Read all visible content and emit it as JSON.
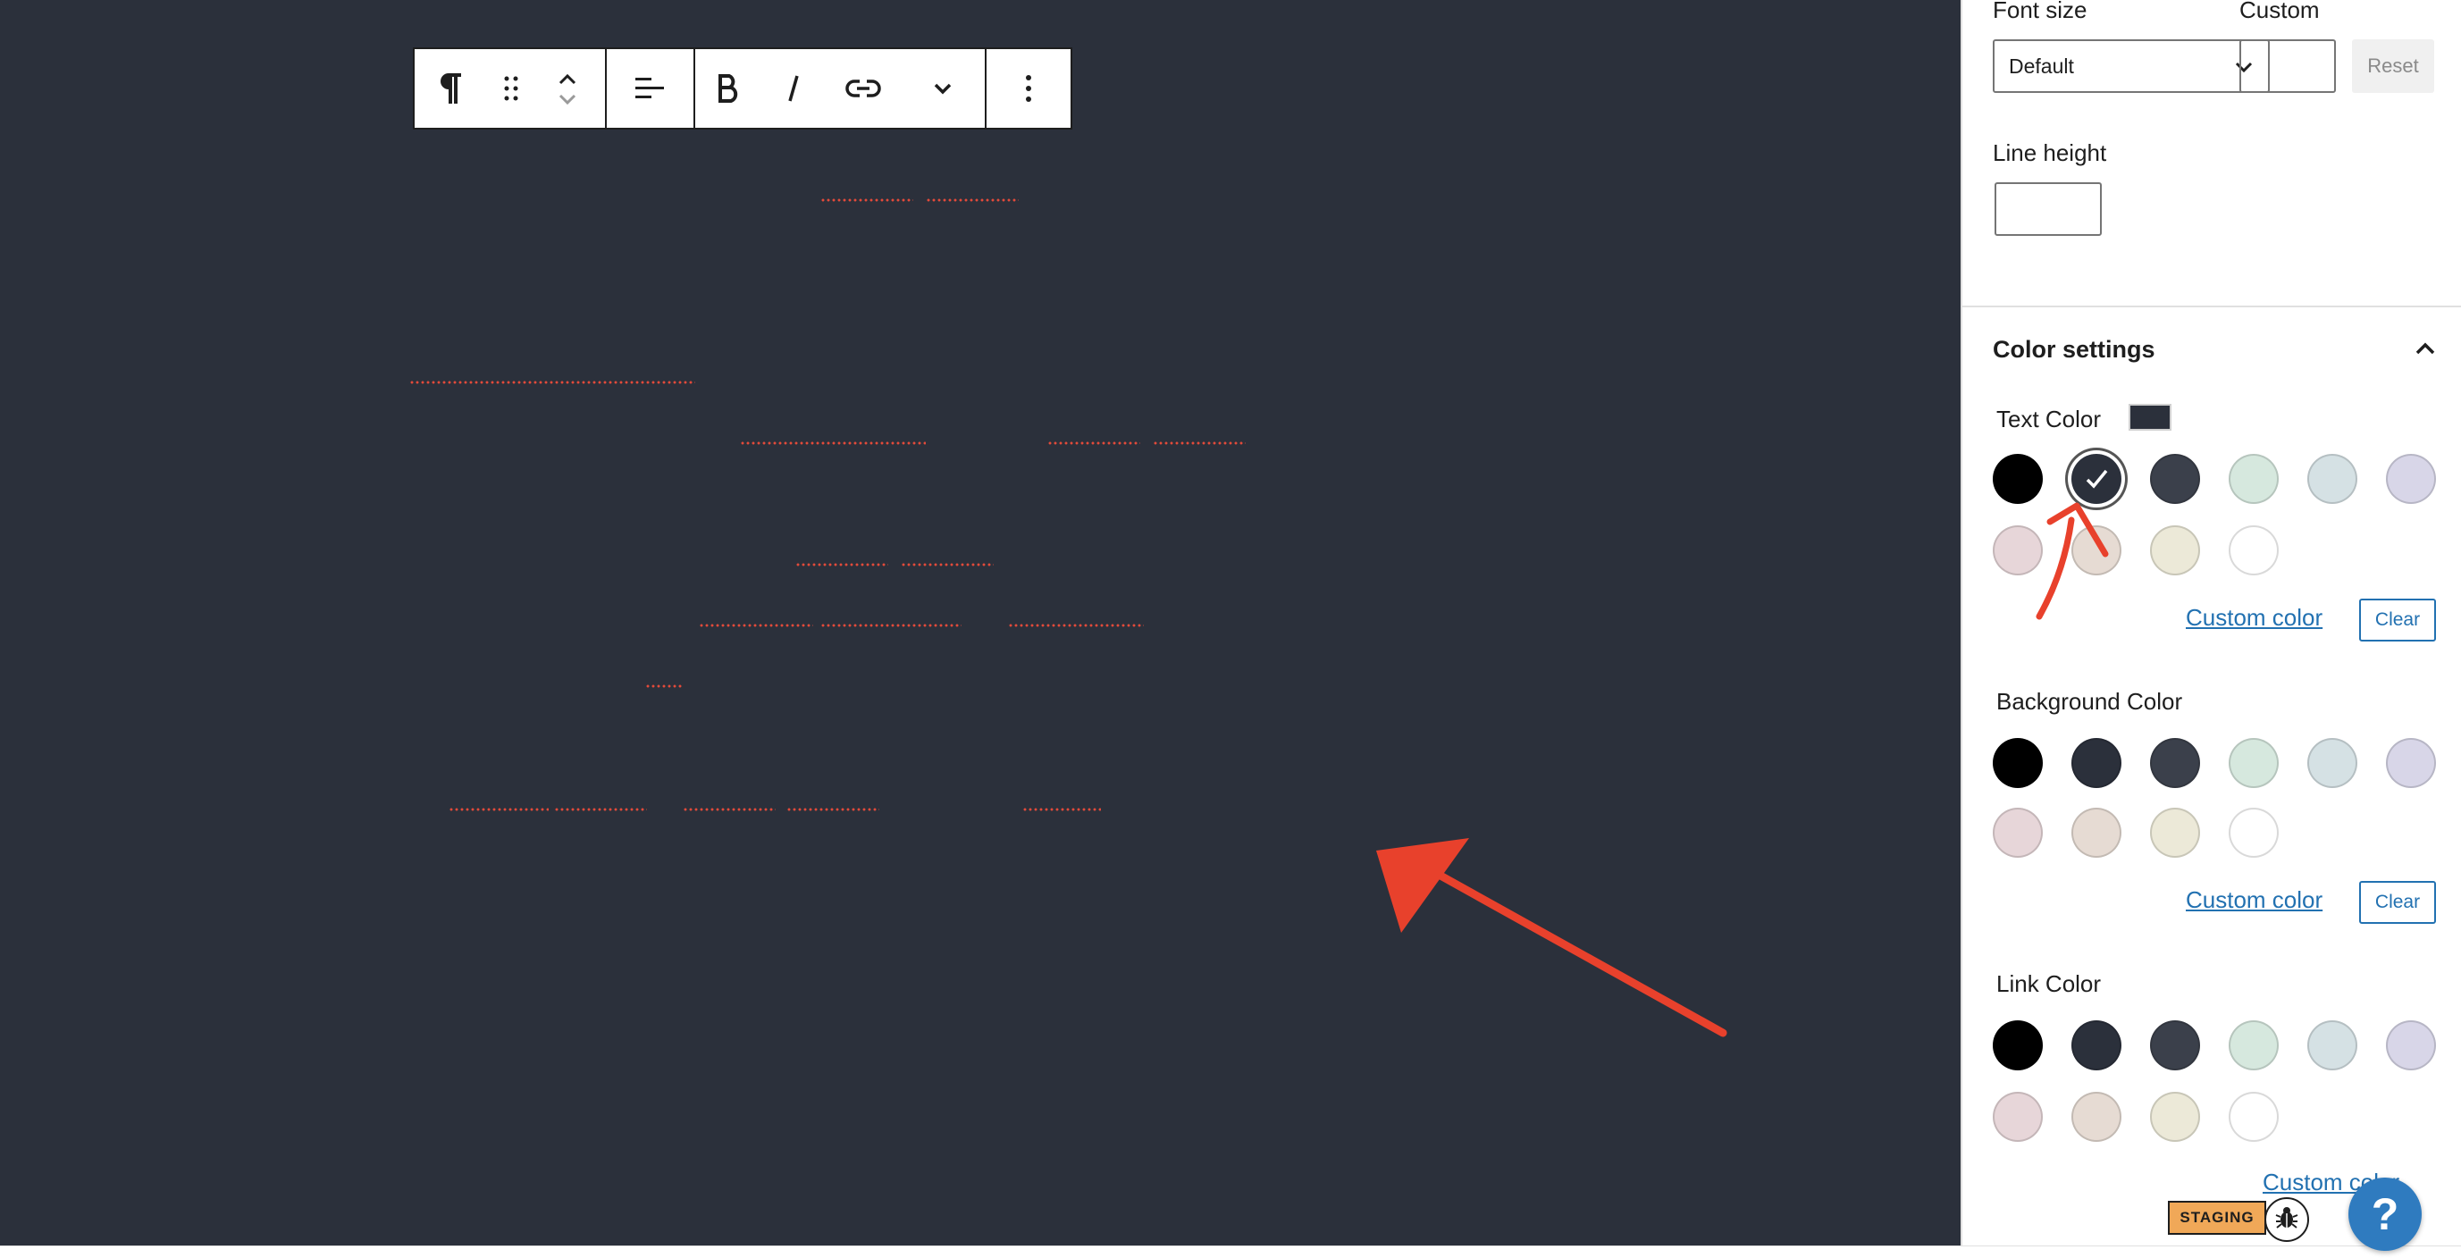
{
  "sidebar": {
    "font_size_label": "Font size",
    "custom_label": "Custom",
    "font_size_select": "Default",
    "reset_label": "Reset",
    "line_height_label": "Line height",
    "color_settings_title": "Color settings",
    "text_color_label": "Text Color",
    "background_color_label": "Background Color",
    "link_color_label": "Link Color",
    "custom_color_label": "Custom color",
    "clear_label": "Clear",
    "palette": [
      "#000000",
      "#2b303b",
      "#3b404b",
      "#d6e8de",
      "#d5e1e4",
      "#d8d6e8",
      "#e7d6d9",
      "#e6dbd3",
      "#ece9d8",
      "#ffffff"
    ],
    "current_text_color": "#2b303b"
  },
  "footer": {
    "staging_label": "STAGING",
    "help_label": "?"
  },
  "colors": {
    "canvas_bg": "#2b303b",
    "accent": "#2271b1",
    "annotation": "#e8412c"
  },
  "icons": [
    "paragraph-icon",
    "drag-handle-icon",
    "chevron-up-icon",
    "chevron-down-icon",
    "align-left-icon",
    "bold-icon",
    "italic-icon",
    "link-icon",
    "more-options-icon",
    "bug-icon"
  ]
}
